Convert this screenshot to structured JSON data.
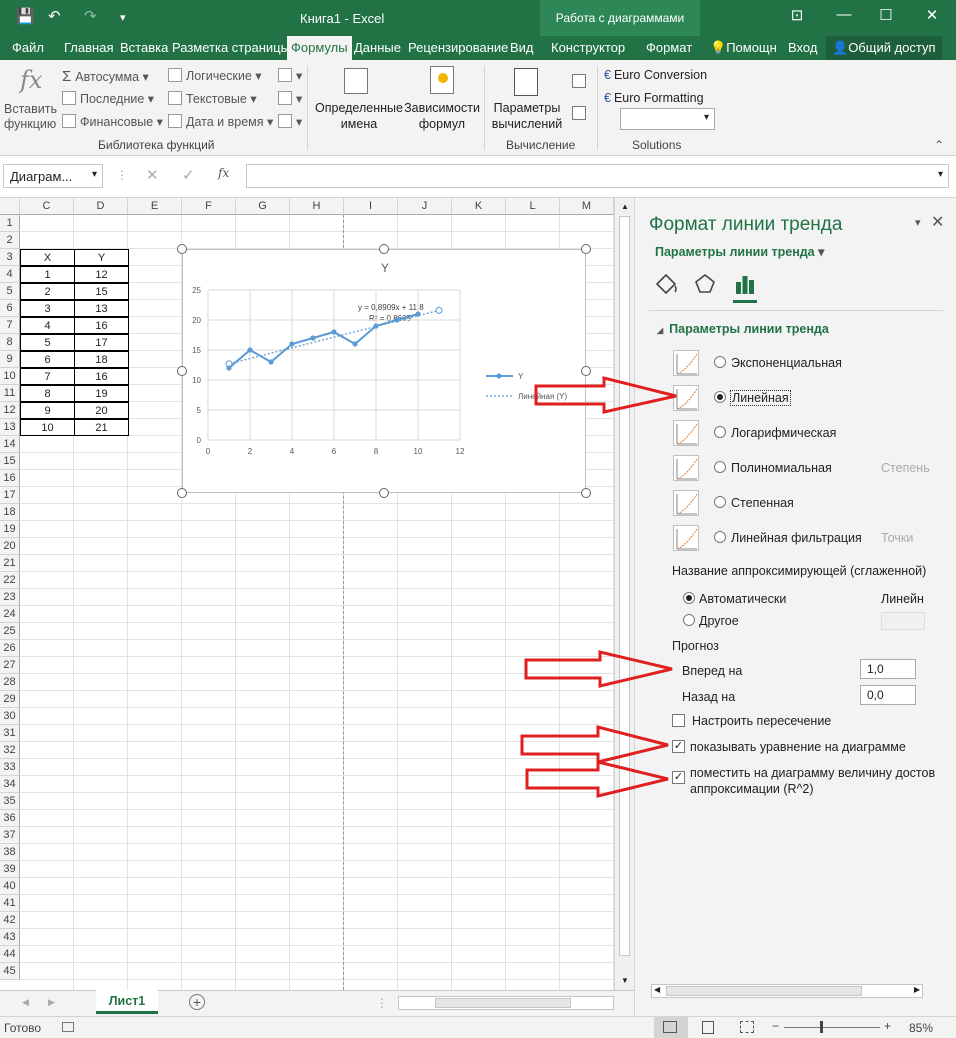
{
  "titlebar": {
    "title": "Книга1 - Excel",
    "context_tab": "Работа с диаграммами",
    "qat": [
      "💾",
      "↶",
      "↷",
      "▾"
    ],
    "controls": [
      "⊡",
      "—",
      "☐",
      "✕"
    ]
  },
  "tabs": [
    "Файл",
    "Главная",
    "Вставка",
    "Разметка страницы",
    "Формулы",
    "Данные",
    "Рецензирование",
    "Вид",
    "Конструктор",
    "Формат",
    "Помощн",
    "Вход",
    "Общий доступ"
  ],
  "active_tab": "Формулы",
  "ribbon": {
    "insert_function": "Вставить функцию",
    "autosum": "Автосумма",
    "recent": "Последние",
    "financial": "Финансовые",
    "logical": "Логические",
    "text": "Текстовые",
    "datetime": "Дата и время",
    "group_library": "Библиотека функций",
    "defined_names": "Определенные имена",
    "dependencies": "Зависимости формул",
    "calc_options": "Параметры вычислений",
    "group_calc": "Вычисление",
    "euro_conversion": "Euro Conversion",
    "euro_formatting": "Euro Formatting",
    "group_solutions": "Solutions"
  },
  "formula_bar": {
    "name_box": "Диаграм...",
    "fx": "fx",
    "value": ""
  },
  "sheet": {
    "columns": [
      "C",
      "D",
      "E",
      "F",
      "G",
      "H",
      "I",
      "J",
      "K",
      "L",
      "M"
    ],
    "rows": [
      1,
      2,
      3,
      4,
      5,
      6,
      7,
      8,
      9,
      10,
      11,
      12,
      13,
      14,
      15,
      16,
      17,
      18,
      19,
      20,
      21,
      22,
      23,
      24,
      25,
      26,
      27,
      28,
      29,
      30,
      31,
      32,
      33,
      34,
      35,
      36,
      37,
      38,
      39,
      40,
      41,
      42,
      43,
      44,
      45
    ],
    "table_header": [
      "X",
      "Y"
    ],
    "table": [
      [
        1,
        12
      ],
      [
        2,
        15
      ],
      [
        3,
        13
      ],
      [
        4,
        16
      ],
      [
        5,
        17
      ],
      [
        6,
        18
      ],
      [
        7,
        16
      ],
      [
        8,
        19
      ],
      [
        9,
        20
      ],
      [
        10,
        21
      ]
    ],
    "sheet_tab": "Лист1",
    "status": "Готово",
    "zoom": "85%"
  },
  "chart_data": {
    "type": "scatter",
    "title": "Y",
    "x": [
      1,
      2,
      3,
      4,
      5,
      6,
      7,
      8,
      9,
      10
    ],
    "series": [
      {
        "name": "Y",
        "values": [
          12,
          15,
          13,
          16,
          17,
          18,
          16,
          19,
          20,
          21
        ]
      }
    ],
    "trendline": {
      "name": "Линейная (Y)",
      "slope": 0.8909,
      "intercept": 11.8,
      "forward": 1.0
    },
    "equation_label": "y = 0,8909x + 11,8",
    "r2_label": "R² = 0,8605",
    "xlim": [
      0,
      12
    ],
    "ylim": [
      0,
      25
    ],
    "xticks": [
      0,
      2,
      4,
      6,
      8,
      10,
      12
    ],
    "yticks": [
      0,
      5,
      10,
      15,
      20,
      25
    ],
    "grid": true,
    "legend_position": "right",
    "color": "#5b9bd5"
  },
  "pane": {
    "title": "Формат линии тренда",
    "subtitle": "Параметры линии тренда",
    "section": "Параметры линии тренда",
    "options": [
      "Экспоненциальная",
      "Линейная",
      "Логарифмическая",
      "Полиномиальная",
      "Степенная",
      "Линейная фильтрация"
    ],
    "selected_option": 1,
    "poly_extra": "Степень",
    "filter_extra": "Точки",
    "name_label": "Название аппроксимирующей (сглаженной)",
    "name_auto": "Автоматически",
    "name_auto_value": "Линейн",
    "name_other": "Другое",
    "forecast": "Прогноз",
    "forward_label": "Вперед на",
    "forward_value": "1,0",
    "backward_label": "Назад на",
    "backward_value": "0,0",
    "intercept_label": "Настроить пересечение",
    "show_eq_label": "показывать уравнение на диаграмме",
    "show_r2_label_1": "поместить на диаграмму величину достов",
    "show_r2_label_2": "аппроксимации (R^2)"
  },
  "annotation_color": "#e02020"
}
